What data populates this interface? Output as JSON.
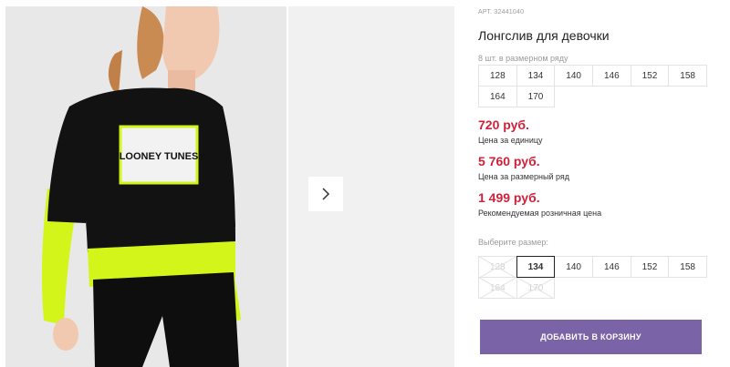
{
  "product": {
    "article": "АРТ. 32441040",
    "title": "Лонгслив для девочки"
  },
  "size_row": {
    "label": "8 шт. в размерном ряду",
    "sizes": [
      "128",
      "134",
      "140",
      "146",
      "152",
      "158",
      "164",
      "170"
    ]
  },
  "prices": {
    "unit_price": "720 руб.",
    "unit_note": "Цена за единицу",
    "row_price": "5 760 руб.",
    "row_note": "Цена за размерный ряд",
    "retail_price": "1 499 руб.",
    "retail_note": "Рекомендуемая розничная цена"
  },
  "size_picker": {
    "label": "Выберите размер:",
    "options": [
      {
        "value": "128",
        "state": "disabled"
      },
      {
        "value": "134",
        "state": "selected"
      },
      {
        "value": "140",
        "state": "available"
      },
      {
        "value": "146",
        "state": "available"
      },
      {
        "value": "152",
        "state": "available"
      },
      {
        "value": "158",
        "state": "available"
      },
      {
        "value": "164",
        "state": "disabled"
      },
      {
        "value": "170",
        "state": "disabled"
      }
    ]
  },
  "actions": {
    "add_to_cart": "ДОБАВИТЬ В КОРЗИНУ"
  },
  "gallery": {
    "print_text": "LOONEY TUNES",
    "next_icon": "chevron-right-icon"
  },
  "colors": {
    "price": "#d0213a",
    "button": "#7b63a8",
    "shirt": "#111111",
    "sleeve": "#d4f51a"
  }
}
